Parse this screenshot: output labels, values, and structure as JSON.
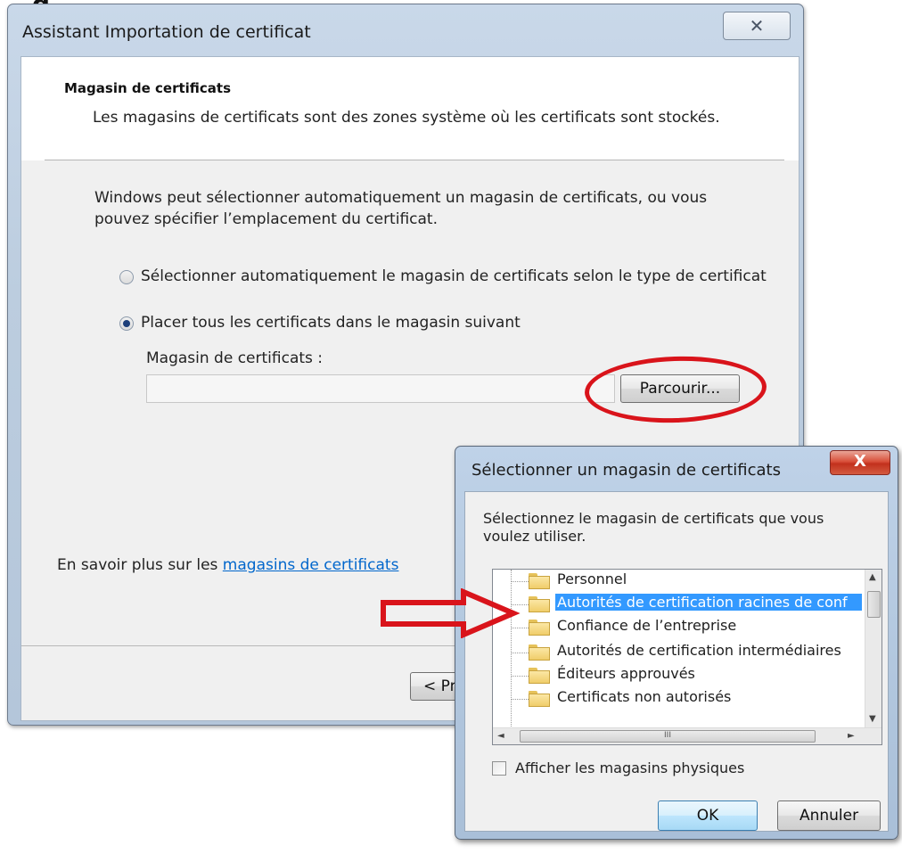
{
  "top_clip_text": "g",
  "wizard": {
    "title": "Assistant Importation de certificat",
    "close_glyph": "✕",
    "header": {
      "title": "Magasin de certificats",
      "description": "Les magasins de certificats sont des zones système où les certificats sont stockés."
    },
    "intro": "Windows peut sélectionner automatiquement un magasin de certificats, ou vous pouvez spécifier l’emplacement du certificat.",
    "options": [
      {
        "label": "Sélectionner automatiquement le magasin de certificats selon le type de certificat",
        "selected": false
      },
      {
        "label": "Placer tous les certificats dans le magasin suivant",
        "selected": true
      }
    ],
    "store_label": "Magasin de certificats :",
    "store_value": "",
    "browse_label": "Parcourir...",
    "learn_more_prefix": "En savoir plus sur les ",
    "learn_more_link": "magasins de certificats",
    "prev_label": "< Pré"
  },
  "dialog": {
    "title": "Sélectionner un magasin de certificats",
    "close_glyph": "X",
    "prompt": "Sélectionnez le magasin de certificats que vous voulez utiliser.",
    "stores": [
      {
        "label": "Personnel",
        "selected": false
      },
      {
        "label": "Autorités de certification racines de conf",
        "selected": true
      },
      {
        "label": "Confiance de l’entreprise",
        "selected": false
      },
      {
        "label": "Autorités de certification intermédiaires",
        "selected": false
      },
      {
        "label": "Éditeurs approuvés",
        "selected": false
      },
      {
        "label": "Certificats non autorisés",
        "selected": false
      }
    ],
    "scroll_up": "▲",
    "scroll_down": "▼",
    "scroll_left": "◄",
    "scroll_right": "►",
    "hscroll_grip": "III",
    "show_physical_label": "Afficher les magasins physiques",
    "show_physical_checked": false,
    "ok_label": "OK",
    "cancel_label": "Annuler"
  },
  "colors": {
    "annotation_red": "#d9141b",
    "selection_blue": "#3399ff",
    "link_blue": "#0066cc"
  }
}
